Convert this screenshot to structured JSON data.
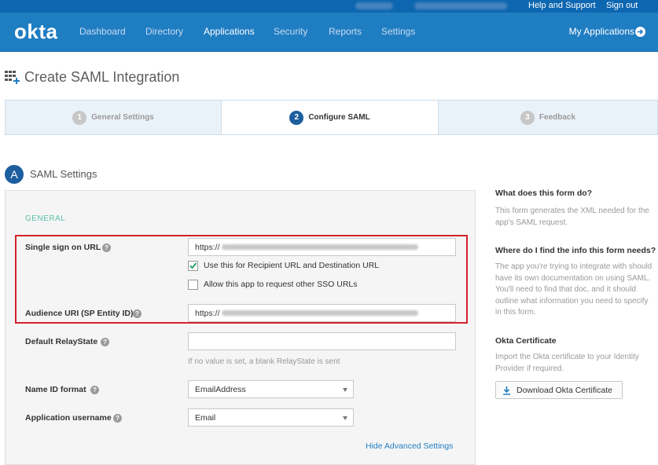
{
  "utility_bar": {
    "help_support": "Help and Support",
    "sign_out": "Sign out"
  },
  "nav": {
    "logo": "okta",
    "items": [
      {
        "label": "Dashboard"
      },
      {
        "label": "Directory"
      },
      {
        "label": "Applications"
      },
      {
        "label": "Security"
      },
      {
        "label": "Reports"
      },
      {
        "label": "Settings"
      }
    ],
    "active_item": "Applications",
    "my_applications": "My Applications"
  },
  "page": {
    "title": "Create SAML Integration"
  },
  "wizard": {
    "steps": [
      {
        "number": "1",
        "label": "General Settings"
      },
      {
        "number": "2",
        "label": "Configure SAML"
      },
      {
        "number": "3",
        "label": "Feedback"
      }
    ],
    "active_step": "2"
  },
  "section": {
    "badge": "A",
    "title": "SAML Settings"
  },
  "form": {
    "group_label": "GENERAL",
    "sso_url": {
      "label": "Single sign on URL",
      "value_prefix": "https://"
    },
    "use_recipient": {
      "label": "Use this for Recipient URL and Destination URL",
      "checked": true
    },
    "allow_other_sso": {
      "label": "Allow this app to request other SSO URLs",
      "checked": false
    },
    "audience_uri": {
      "label": "Audience URI (SP Entity ID)",
      "value_prefix": "https://"
    },
    "relay_state": {
      "label": "Default RelayState",
      "value": "",
      "hint": "If no value is set, a blank RelayState is sent"
    },
    "name_id_format": {
      "label": "Name ID format",
      "value": "EmailAddress"
    },
    "app_username": {
      "label": "Application username",
      "value": "Email"
    },
    "advanced_link": "Hide Advanced Settings"
  },
  "help_panel": {
    "q1": {
      "heading": "What does this form do?",
      "body": "This form generates the XML needed for the app's SAML request."
    },
    "q2": {
      "heading": "Where do I find the info this form needs?",
      "body": "The app you're trying to integrate with should have its own documentation on using SAML. You'll need to find that doc, and it should outline what information you need to specify in this form."
    },
    "cert": {
      "heading": "Okta Certificate",
      "body": "Import the Okta certificate to your Identity Provider if required.",
      "button": "Download Okta Certificate"
    }
  },
  "colors": {
    "nav_bg": "#1f7dc2",
    "util_bg": "#0d66b0",
    "accent": "#1d5e9e",
    "highlight_border": "#d2232a",
    "group_label": "#5bbfa6"
  },
  "icons": [
    "apps-grid-add-icon",
    "arrow-right-circle-icon",
    "question-icon",
    "checkmark-icon",
    "download-icon",
    "caret-down-icon"
  ]
}
